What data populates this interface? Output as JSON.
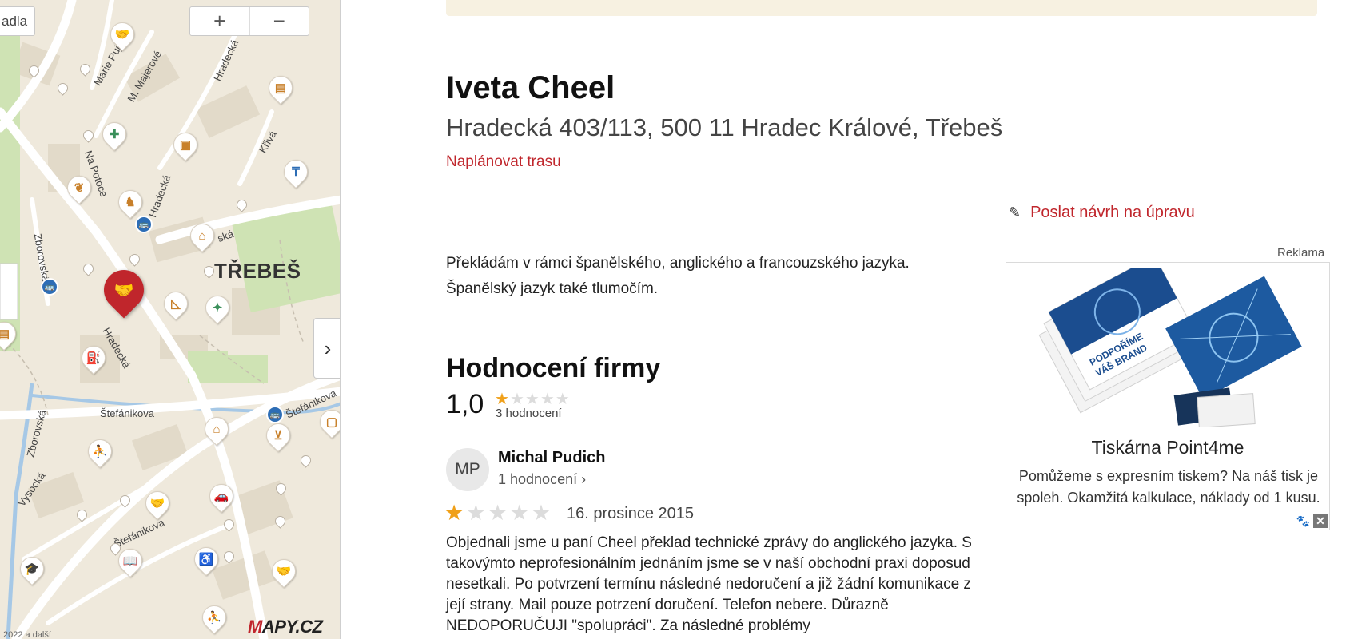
{
  "map": {
    "search_fragment": "adla",
    "zoom_in": "+",
    "zoom_out": "−",
    "collapse_arrow": "›",
    "labels": {
      "district": "TŘEBEŠ",
      "street_1": "Marie Pujm",
      "street_2": "M. Majerové",
      "street_3": "Hradecká",
      "street_4": "Na Potoce",
      "street_5": "Zborovská",
      "street_6": "Hradecká",
      "street_7": "Štefánikova",
      "street_8": "Štefánikova",
      "street_9": "Zborovská",
      "street_10": "Vysocká",
      "street_11": "Štefánikova",
      "street_12": "Křivá",
      "street_13": "ská",
      "street_14": "Hradecká"
    },
    "logo_m": "M",
    "logo_rest": "APY.CZ",
    "copyright": "2022 a další"
  },
  "detail": {
    "title": "Iveta Cheel",
    "address": "Hradecká 403/113, 500 11 Hradec Králové, Třebeš",
    "route_link": "Naplánovat trasu",
    "edit_link": "Poslat návrh na úpravu",
    "description": "Překládám v rámci španělského, anglického a francouzského jazyka. Španělský jazyk také tlumočím.",
    "rating": {
      "heading": "Hodnocení firmy",
      "score": "1,0",
      "stars_filled": 1,
      "stars_total": 5,
      "count": "3 hodnocení"
    },
    "review": {
      "initials": "MP",
      "author": "Michal Pudich",
      "author_count": "1 hodnocení ›",
      "stars_filled": 1,
      "date": "16. prosince 2015",
      "text": "Objednali jsme u paní Cheel překlad technické zprávy do anglického jazyka. S takovýmto neprofesionálním jednáním jsme se v naší obchodní praxi doposud nesetkali. Po potvrzení termínu následné nedoručení a již žádní komunikace z její strany. Mail pouze potrzení doručení. Telefon nebere. Důrazně NEDOPORUČUJI \"spolupráci\". Za následné problémy"
    }
  },
  "ad": {
    "label": "Reklama",
    "title": "Tiskárna Point4me",
    "text": "Pomůžeme s expresním tiskem? Na náš tisk je spoleh. Okamžitá kalkulace, náklady od 1 kusu.",
    "brochure_text_1": "PODPOŘÍME",
    "brochure_text_2": "VÁŠ BRAND",
    "close": "✕"
  },
  "colors": {
    "accent_red": "#c0262c",
    "star_orange": "#f0a019",
    "map_bg": "#efe9dc"
  }
}
